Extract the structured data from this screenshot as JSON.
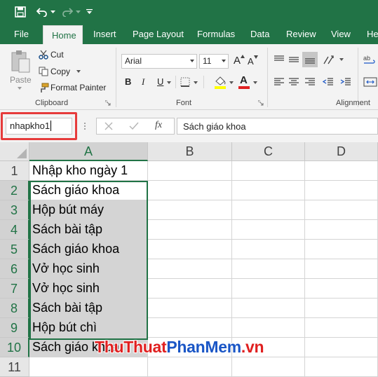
{
  "ribbon_tabs": [
    {
      "label": "File"
    },
    {
      "label": "Home",
      "active": true
    },
    {
      "label": "Insert"
    },
    {
      "label": "Page Layout"
    },
    {
      "label": "Formulas"
    },
    {
      "label": "Data"
    },
    {
      "label": "Review"
    },
    {
      "label": "View"
    },
    {
      "label": "He"
    }
  ],
  "clipboard": {
    "paste_label": "Paste",
    "cut_label": "Cut",
    "copy_label": "Copy",
    "format_painter_label": "Format Painter",
    "group_label": "Clipboard"
  },
  "font": {
    "family": "Arial",
    "size": "11",
    "bold_label": "B",
    "italic_label": "I",
    "underline_label": "U",
    "grow_label": "A",
    "shrink_label": "A",
    "font_color_label": "A",
    "group_label": "Font"
  },
  "alignment": {
    "group_label": "Alignment"
  },
  "formula_bar": {
    "name_box": "nhapkho1",
    "fx_label": "fx",
    "value": "Sách giáo khoa"
  },
  "sheet": {
    "columns": [
      "A",
      "B",
      "C",
      "D"
    ],
    "rows": [
      {
        "num": "1",
        "a": "Nhập kho ngày 1"
      },
      {
        "num": "2",
        "a": "Sách giáo khoa"
      },
      {
        "num": "3",
        "a": "Hộp bút máy"
      },
      {
        "num": "4",
        "a": "Sách bài tập"
      },
      {
        "num": "5",
        "a": "Sách giáo khoa"
      },
      {
        "num": "6",
        "a": "Vở học sinh"
      },
      {
        "num": "7",
        "a": "Vở học sinh"
      },
      {
        "num": "8",
        "a": "Sách bài tập"
      },
      {
        "num": "9",
        "a": "Hộp bút chì"
      },
      {
        "num": "10",
        "a": "Sách giáo khoa"
      },
      {
        "num": "11",
        "a": ""
      }
    ]
  },
  "watermark": {
    "part1": "ThuThuat",
    "part2": "PhanMem",
    "part3": ".vn"
  },
  "colors": {
    "accent": "#217346",
    "highlight": "#e63b3b",
    "range_fill": "#d4d4d4"
  }
}
